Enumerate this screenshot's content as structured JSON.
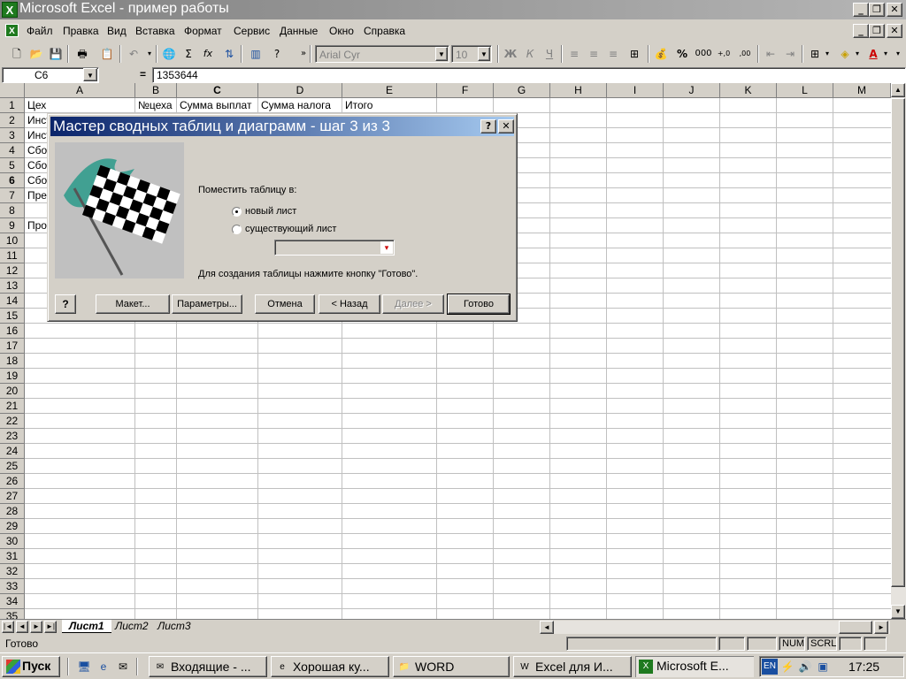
{
  "window": {
    "title": "Microsoft Excel - пример работы",
    "app_icon": "X",
    "controls": [
      "_",
      "❐",
      "✕"
    ]
  },
  "menu": {
    "items": [
      "Файл",
      "Правка",
      "Вид",
      "Вставка",
      "Формат",
      "Сервис",
      "Данные",
      "Окно",
      "Справка"
    ],
    "doc_controls": [
      "_",
      "❐",
      "✕"
    ]
  },
  "toolbar": {
    "font_name": "Arial Cyr",
    "font_size": "10",
    "bold": "Ж",
    "italic": "К",
    "underline": "Ч",
    "percent": "%",
    "thousands": "000",
    "inc_decimal": "+,0",
    "dec_decimal": ",00"
  },
  "formula_bar": {
    "name_box": "C6",
    "equals": "=",
    "value": "1353644"
  },
  "sheet": {
    "columns": [
      "A",
      "B",
      "C",
      "D",
      "E",
      "F",
      "G",
      "H",
      "I",
      "J",
      "K",
      "L",
      "M"
    ],
    "active_column": "C",
    "rows": [
      "1",
      "2",
      "3",
      "4",
      "5",
      "6",
      "7",
      "8",
      "9",
      "10",
      "11",
      "12",
      "13",
      "14",
      "15",
      "16",
      "17",
      "18",
      "19",
      "20",
      "21",
      "22",
      "23",
      "24",
      "25",
      "26",
      "27",
      "28",
      "29",
      "30",
      "31",
      "32",
      "33",
      "34",
      "35"
    ],
    "active_row": "6",
    "header_row": {
      "a": "Цех",
      "b": "№цеха",
      "c": "Сумма выплат",
      "d": "Сумма налога",
      "e": "Итого"
    },
    "col_a": [
      "Инст",
      "Инст",
      "Сбо",
      "Сбо",
      "Сбо",
      "Пре",
      "",
      "Про"
    ]
  },
  "tabs": {
    "nav": [
      "|◄",
      "◄",
      "►",
      "►|"
    ],
    "sheets": [
      "Лист1",
      "Лист2",
      "Лист3"
    ]
  },
  "status": {
    "text": "Готово",
    "num": "NUM",
    "scrl": "SCRL"
  },
  "taskbar": {
    "start": "Пуск",
    "tasks": [
      "Входящие - ...",
      "Хорошая ку...",
      "WORD",
      "Excel для И...",
      "Microsoft E..."
    ],
    "lang": "EN",
    "clock": "17:25"
  },
  "dialog": {
    "title": "Мастер сводных таблиц и диаграмм - шаг 3 из 3",
    "help": "?",
    "close": "✕",
    "place_label": "Поместить таблицу в:",
    "radio_new": "новый лист",
    "radio_existing": "существующий лист",
    "hint": "Для создания таблицы нажмите кнопку \"Готово\".",
    "buttons": {
      "layout": "Макет...",
      "params": "Параметры...",
      "cancel": "Отмена",
      "back": "< Назад",
      "next": "Далее >",
      "finish": "Готово"
    }
  }
}
